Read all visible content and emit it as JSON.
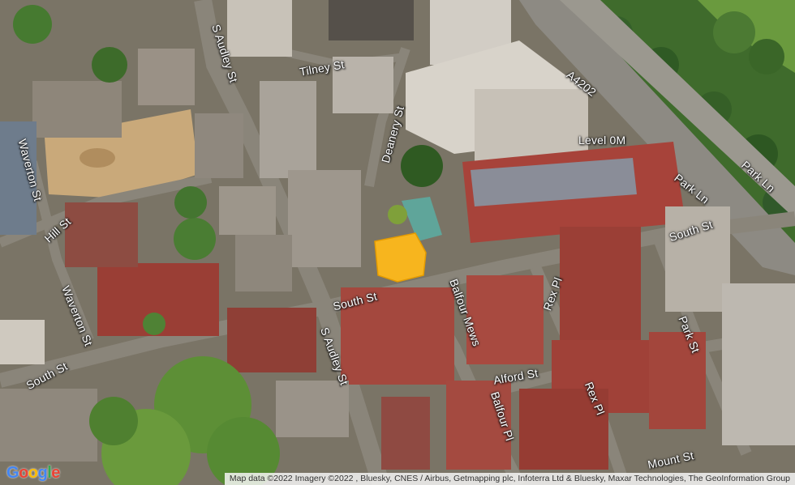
{
  "map": {
    "view": "satellite-3d",
    "highlight_color": "#f7b51e",
    "streets": {
      "s_audley_st_north": "S Audley St",
      "tilney_st": "Tilney St",
      "deanery_st": "Deanery St",
      "a4202": "A4202",
      "park_ln": "Park Ln",
      "park_ln_east": "Park Ln",
      "level_0m": "Level 0M",
      "waverton_st_north": "Waverton St",
      "hill_st": "Hill St",
      "waverton_st_south": "Waverton St",
      "south_st_west": "South St",
      "south_st_center": "South St",
      "balfour_mews": "Balfour Mews",
      "rex_pl_north": "Rex Pl",
      "south_st_east": "South St",
      "park_st": "Park St",
      "s_audley_st_south": "S Audley St",
      "alford_st": "Alford St",
      "rex_pl_south": "Rex Pl",
      "balfour_pl": "Balfour Pl",
      "mount_st": "Mount St"
    },
    "logo": {
      "letters": [
        "G",
        "o",
        "o",
        "g",
        "l",
        "e"
      ],
      "colors": [
        "#4285f4",
        "#ea4335",
        "#fbbc05",
        "#4285f4",
        "#34a853",
        "#ea4335"
      ]
    },
    "attribution": "Map data ©2022 Imagery ©2022 , Bluesky, CNES / Airbus, Getmapping plc, Infoterra Ltd & Bluesky, Maxar Technologies, The GeoInformation Group"
  }
}
